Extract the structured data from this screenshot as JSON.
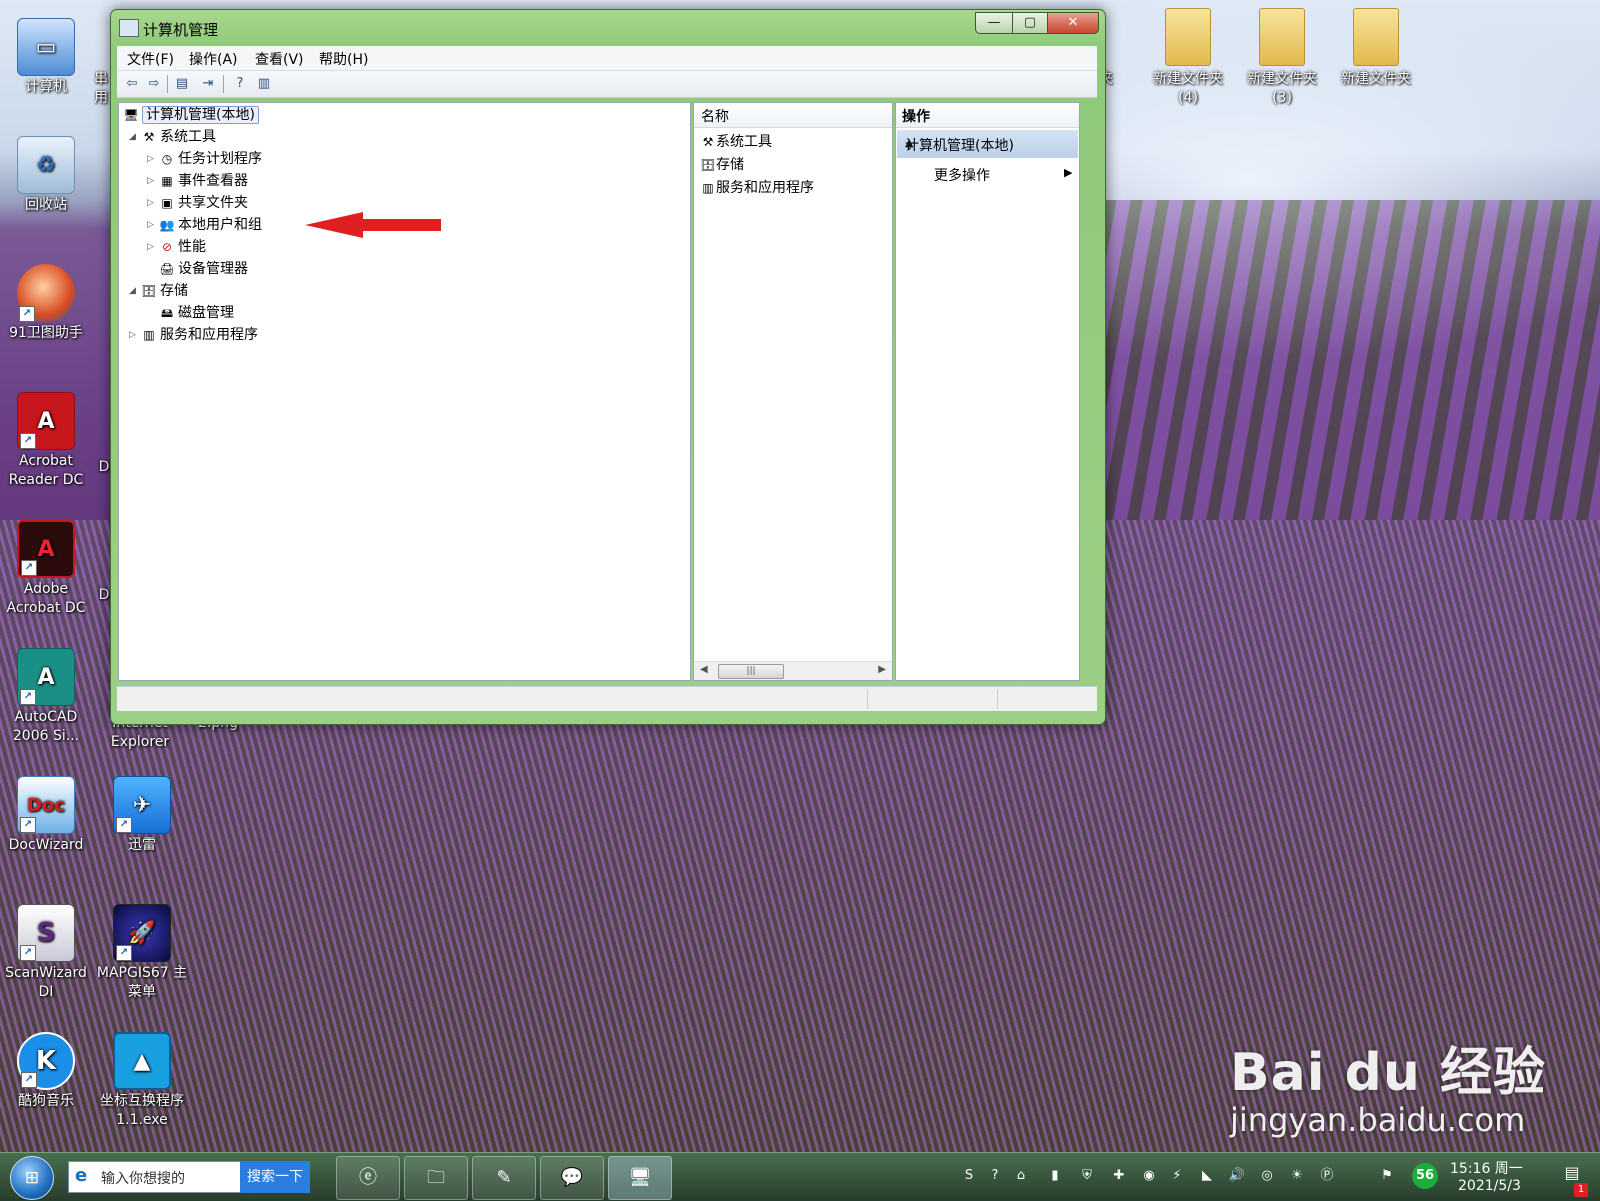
{
  "desktop": {
    "icons_left": [
      {
        "label": "计算机",
        "glyph": "computer-icon"
      },
      {
        "label": "回收站",
        "glyph": "recycle-bin-icon"
      },
      {
        "label": "91卫图助手",
        "glyph": "globe-icon"
      },
      {
        "label": "Acrobat Reader DC",
        "glyph": "acrobat-icon"
      },
      {
        "label": "Adobe Acrobat DC",
        "glyph": "acrobat-icon"
      },
      {
        "label": "AutoCAD 2006 Si...",
        "glyph": "autocad-icon"
      },
      {
        "label": "DocWizard",
        "glyph": "doc-icon"
      },
      {
        "label": "ScanWizard DI",
        "glyph": "scanwizard-icon"
      },
      {
        "label": "酷狗音乐",
        "glyph": "kugou-icon"
      }
    ],
    "icons_col2": [
      {
        "label": "Internet Explorer",
        "glyph": "ie-icon"
      },
      {
        "label": "迅雷",
        "glyph": "xunlei-icon"
      },
      {
        "label": "MAPGIS67 主菜单",
        "glyph": "mapgis-icon"
      },
      {
        "label": "坐标互换程序 1.1.exe",
        "glyph": "coord-icon"
      }
    ],
    "partial_labels": {
      "col2_top": "串用",
      "png": "2.png",
      "d1": "D",
      "d2": "D",
      "jia": "夹"
    },
    "folders_right": [
      {
        "label": "新建文件夹 (4)"
      },
      {
        "label": "新建文件夹 (3)"
      },
      {
        "label": "新建文件夹"
      }
    ]
  },
  "window": {
    "title": "计算机管理",
    "caption": {
      "min": "—",
      "max": "▢",
      "close": "✕"
    },
    "menu": [
      "文件(F)",
      "操作(A)",
      "查看(V)",
      "帮助(H)"
    ],
    "tree": {
      "root": "计算机管理(本地)",
      "system_tools": "系统工具",
      "task_scheduler": "任务计划程序",
      "event_viewer": "事件查看器",
      "shared_folders": "共享文件夹",
      "local_users": "本地用户和组",
      "performance": "性能",
      "device_manager": "设备管理器",
      "storage": "存储",
      "disk_management": "磁盘管理",
      "services_apps": "服务和应用程序"
    },
    "list": {
      "header": "名称",
      "items": [
        "系统工具",
        "存储",
        "服务和应用程序"
      ]
    },
    "actions": {
      "header": "操作",
      "section": "计算机管理(本地)",
      "more": "更多操作"
    }
  },
  "taskbar": {
    "search_placeholder": "输入你想搜的",
    "search_button": "搜索一下",
    "tray_badge": "56",
    "time": "15:16 周一",
    "date": "2021/5/3",
    "notification_count": "1"
  },
  "watermark": {
    "brand": "Bai du 经验",
    "url": "jingyan.baidu.com"
  },
  "colors": {
    "arrow": "#e02020",
    "title_bar": "#a8d88f",
    "selection": "#e8f0fb"
  }
}
